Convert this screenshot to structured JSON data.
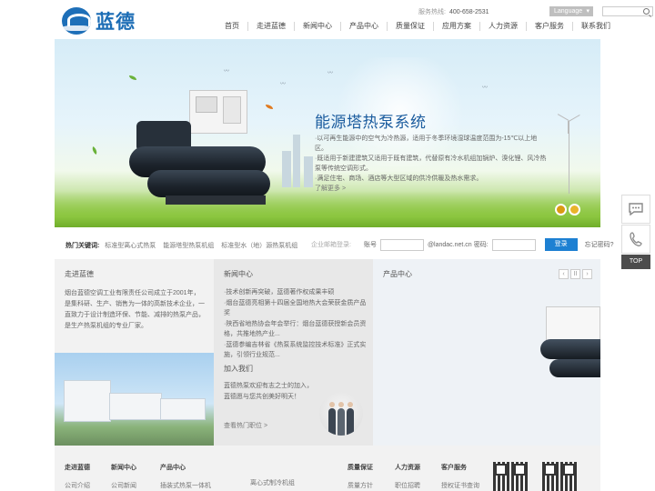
{
  "header": {
    "logo_text": "蓝德",
    "hotline_label": "服务热线:",
    "hotline_number": "400-658-2531",
    "language_label": "Language",
    "nav": [
      "首页",
      "走进蓝德",
      "新闻中心",
      "产品中心",
      "质量保证",
      "应用方案",
      "人力资源",
      "客户服务",
      "联系我们"
    ]
  },
  "banner": {
    "title": "能源塔热泵系统",
    "lines": [
      "·以可再生能源中的空气为冷热源，适用于冬季环境湿球温度范围为-15℃以上地区。",
      "·既适用于新建建筑又适用于既有建筑，代替原有冷水机组加锅炉、溴化锂、风冷热",
      "  泵等传统空调形式。",
      "·满足住宅、商场、酒店等大型区域的供冷供暖及热水需求。"
    ],
    "more": "了解更多 >"
  },
  "side_tools": {
    "top_label": "TOP",
    "chat_icon": "chat-bubble-icon",
    "phone_icon": "phone-icon"
  },
  "hotwords": {
    "label": "热门关键词:",
    "items": [
      "标准型离心式热泵",
      "能源塔型热泵机组",
      "标准型水（地）源热泵机组"
    ]
  },
  "login": {
    "title": "企业邮箱登录:",
    "account_label": "账号",
    "domain": "@landac.net.cn",
    "password_label": "密码:",
    "submit": "登录",
    "forgot": "忘记密码?"
  },
  "about": {
    "title": "走进蓝德",
    "text": "烟台蓝德空调工业有限责任公司成立于2001年，是集科研、生产、销售为一体的高新技术企业，一直致力于设计制造环保、节能、减排的热泵产品，是生产热泵机组的专业厂家。"
  },
  "news": {
    "title": "新闻中心",
    "items": [
      "·技术创新再突破，蓝德著作权成果丰硕",
      "·烟台蓝德亮相第十四届全国地热大会荣获金质产品奖",
      "·陕西省地热协会年会举行：烟台蓝德获授新会员资格，共推地热产业...",
      "·蓝德参编吉林省《热泵系统监控技术标准》正式实施，引领行业规范..."
    ]
  },
  "join": {
    "title": "加入我们",
    "text": "蓝德热泵欢迎有志之士的加入，蓝德愿与您共创美好明天！",
    "jobs_link": "查看热门职位 >"
  },
  "products": {
    "title": "产品中心",
    "prev": "‹",
    "pause": "II",
    "next": "›"
  },
  "footer": {
    "columns": [
      {
        "title": "走进蓝德",
        "link": "公司介绍"
      },
      {
        "title": "新闻中心",
        "link": "公司新闻"
      },
      {
        "title": "产品中心",
        "link": "插装式热泵一体机"
      },
      {
        "title": "",
        "link": "离心式制冷机组"
      },
      {
        "title": "质量保证",
        "link": "质量方针"
      },
      {
        "title": "人力资源",
        "link": "职位招聘"
      },
      {
        "title": "客户服务",
        "link": "授权证书查询"
      }
    ]
  },
  "colors": {
    "brand_blue": "#1c6db5",
    "button_blue": "#1d80d2",
    "banner_green": "#8cc640",
    "dot_gold": "#e9b42a"
  }
}
